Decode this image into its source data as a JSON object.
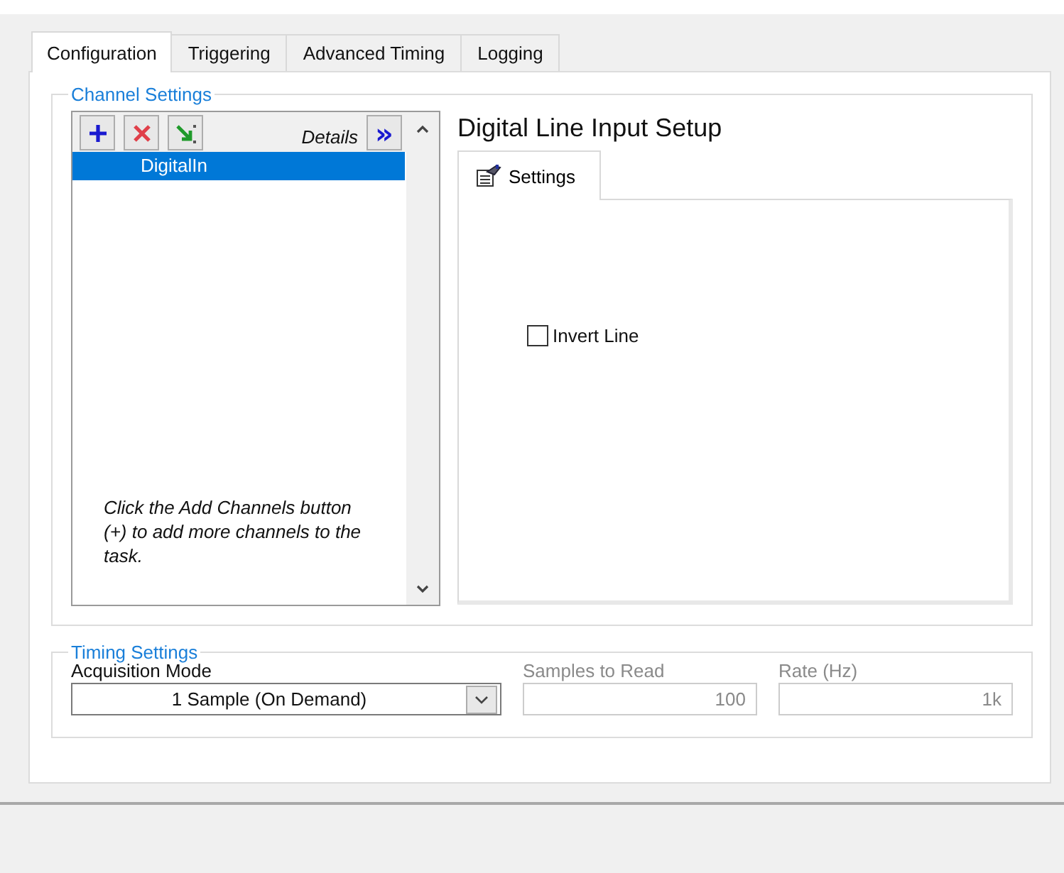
{
  "tabs": [
    {
      "label": "Configuration",
      "selected": true
    },
    {
      "label": "Triggering",
      "selected": false
    },
    {
      "label": "Advanced Timing",
      "selected": false
    },
    {
      "label": "Logging",
      "selected": false
    }
  ],
  "channel_settings": {
    "title": "Channel Settings",
    "details_label": "Details",
    "details_button": "»",
    "channels": [
      {
        "name": "DigitalIn",
        "selected": true
      }
    ],
    "hint": "Click the Add Channels button (+) to add more channels to the task."
  },
  "setup": {
    "title": "Digital Line Input Setup",
    "tabs": [
      {
        "label": "Settings",
        "selected": true
      }
    ],
    "invert_line": {
      "label": "Invert Line",
      "checked": false
    }
  },
  "timing_settings": {
    "title": "Timing Settings",
    "fields": [
      {
        "kind": "dropdown",
        "label": "Acquisition Mode",
        "value": "1 Sample (On Demand)",
        "disabled": false
      },
      {
        "kind": "number",
        "label": "Samples to Read",
        "value": "100",
        "disabled": true
      },
      {
        "kind": "number",
        "label": "Rate (Hz)",
        "value": "1k",
        "disabled": true
      }
    ]
  }
}
